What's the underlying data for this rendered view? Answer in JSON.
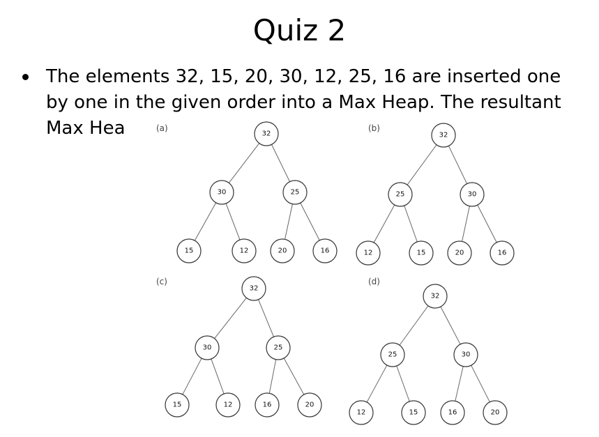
{
  "slide": {
    "title": "Quiz 2",
    "bullet": "The elements 32, 15, 20, 30, 12, 25, 16 are inserted one by one in the given order into a Max Heap. The resultant Max Heap is."
  },
  "options": [
    {
      "label": "(a)",
      "nodes": [
        "32",
        "30",
        "25",
        "15",
        "12",
        "20",
        "16"
      ]
    },
    {
      "label": "(b)",
      "nodes": [
        "32",
        "25",
        "30",
        "12",
        "15",
        "20",
        "16"
      ]
    },
    {
      "label": "(c)",
      "nodes": [
        "32",
        "30",
        "25",
        "15",
        "12",
        "16",
        "20"
      ]
    },
    {
      "label": "(d)",
      "nodes": [
        "32",
        "25",
        "30",
        "12",
        "15",
        "16",
        "20"
      ]
    }
  ]
}
